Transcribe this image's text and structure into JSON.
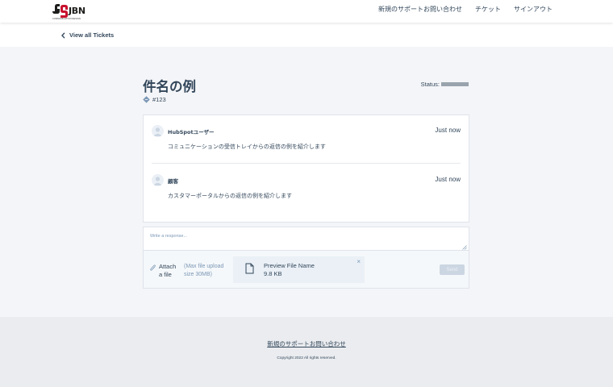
{
  "header": {
    "logo_text": "JBN",
    "logo_subtext": "COMMUNICATION DESIGN",
    "nav": [
      {
        "label": "新規のサポートお問い合わせ"
      },
      {
        "label": "チケット"
      },
      {
        "label": "サインアウト"
      }
    ]
  },
  "subbar": {
    "back_label": "View all Tickets"
  },
  "ticket": {
    "title": "件名の例",
    "id": "#123",
    "status_label": "Status:"
  },
  "messages": [
    {
      "author": "HubSpotユーザー",
      "time": "Just now",
      "body": "コミュニケーションの受信トレイからの返信の例を紹介します"
    },
    {
      "author": "顧客",
      "time": "Just now",
      "body": "カスタマーポータルからの返信の例を紹介します"
    }
  ],
  "reply": {
    "placeholder": "Write a response...",
    "attach_label": "Attach a file",
    "attach_hint": "(Max file upload size 30MB)",
    "file": {
      "name": "Preview File Name",
      "size": "9.8 KB",
      "close": "×"
    },
    "send_label": "Send"
  },
  "footer": {
    "link": "新規のサポートお問い合わせ",
    "copyright": "Copyright 2022 All rights reserved."
  },
  "colors": {
    "text": "#33475b",
    "muted": "#7c98b6",
    "logo_red": "#c8102e",
    "page_bg": "#f4f5f8"
  },
  "icons": {
    "back": "chevron-left-icon",
    "ticket": "ticket-tag-icon",
    "avatar": "user-avatar-icon",
    "attach": "paperclip-icon",
    "file": "document-icon",
    "close": "close-icon"
  }
}
